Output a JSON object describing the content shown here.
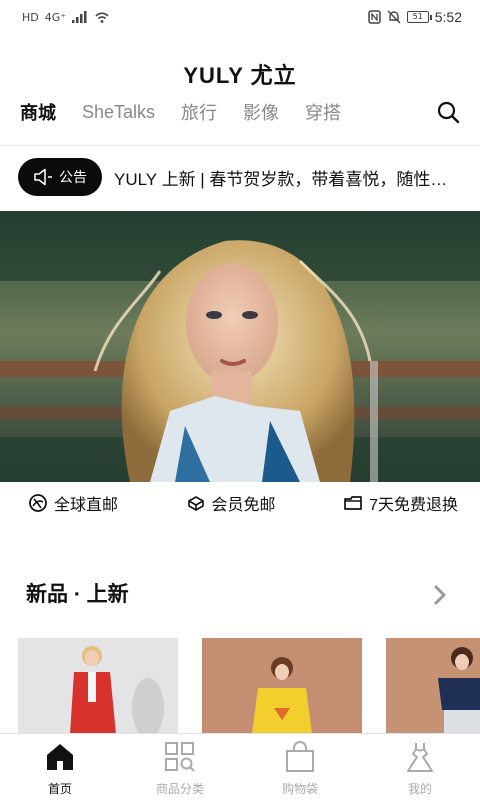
{
  "status_bar": {
    "left_indicators": [
      "HD",
      "4G",
      "signal",
      "wifi"
    ],
    "network": "4G⁺",
    "battery": "51",
    "time": "5:52"
  },
  "app": {
    "title": "YULY 尤立"
  },
  "nav": {
    "tabs": [
      {
        "label": "商城",
        "active": true
      },
      {
        "label": "SheTalks",
        "active": false
      },
      {
        "label": "旅行",
        "active": false
      },
      {
        "label": "影像",
        "active": false
      },
      {
        "label": "穿搭",
        "active": false
      }
    ],
    "search_icon": "search-icon"
  },
  "notice": {
    "badge": "公告",
    "text": "YULY 上新 | 春节贺岁款，带着喜悦，随性…"
  },
  "hero": {
    "image": "model-portrait"
  },
  "services": [
    {
      "icon": "globe-icon",
      "label": "全球直邮"
    },
    {
      "icon": "gift-icon",
      "label": "会员免邮"
    },
    {
      "icon": "box-icon",
      "label": "7天免费退换"
    }
  ],
  "section": {
    "title": "新品 · 上新",
    "more_icon": "chevron-right-icon"
  },
  "products": [
    {
      "image": "red-cardigan-model",
      "bg": "#e4e4e6"
    },
    {
      "image": "yellow-hoodie-model",
      "bg": "#c48e72"
    },
    {
      "image": "navy-top-model",
      "bg": "#c59274"
    }
  ],
  "bottom_nav": [
    {
      "label": "首页",
      "icon": "home-icon",
      "active": true
    },
    {
      "label": "商品分类",
      "icon": "category-icon",
      "active": false
    },
    {
      "label": "购物袋",
      "icon": "bag-icon",
      "active": false
    },
    {
      "label": "我的",
      "icon": "dress-icon",
      "active": false
    }
  ],
  "colors": {
    "accent": "#0b0b0b",
    "inactive": "#aaaaaa",
    "text": "#111111"
  }
}
